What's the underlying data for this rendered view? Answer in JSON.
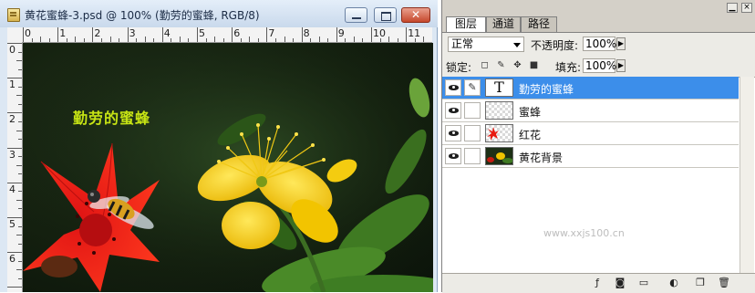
{
  "document": {
    "title": "黄花蜜蜂-3.psd @ 100% (勤劳的蜜蜂, RGB/8)",
    "ruler_top_numbers": [
      "0",
      "1",
      "2",
      "3",
      "4",
      "5",
      "6",
      "7",
      "8",
      "9",
      "10",
      "11"
    ],
    "ruler_left_numbers": [
      "0",
      "1",
      "2",
      "3",
      "4",
      "5",
      "6"
    ],
    "canvas_text": "勤劳的蜜蜂",
    "canvas_text_color": "#c7e414",
    "window_buttons": {
      "minimize": "minimize-icon",
      "maximize": "maximize-icon",
      "close": "close-icon"
    }
  },
  "layers_panel": {
    "tabs": [
      {
        "label": "图层",
        "active": true
      },
      {
        "label": "通道",
        "active": false
      },
      {
        "label": "路径",
        "active": false
      }
    ],
    "blend_mode": "正常",
    "opacity_label": "不透明度:",
    "opacity_value": "100%",
    "lock_label": "锁定:",
    "fill_label": "填充:",
    "fill_value": "100%",
    "layers": [
      {
        "name": "勤劳的蜜蜂",
        "type": "text",
        "thumb_text": "T",
        "visible": true,
        "selected": true
      },
      {
        "name": "蜜蜂",
        "type": "image",
        "visible": true,
        "selected": false
      },
      {
        "name": "红花",
        "type": "image",
        "visible": true,
        "selected": false
      },
      {
        "name": "黄花背景",
        "type": "image",
        "visible": true,
        "selected": false
      }
    ],
    "watermark": "www.xxjs100.cn",
    "selected_color": "#3c8eea",
    "bottom_icons": [
      "link-layers-icon",
      "layer-style-icon",
      "layer-mask-icon",
      "new-group-icon",
      "adjustment-layer-icon",
      "new-layer-icon",
      "delete-layer-icon"
    ]
  }
}
